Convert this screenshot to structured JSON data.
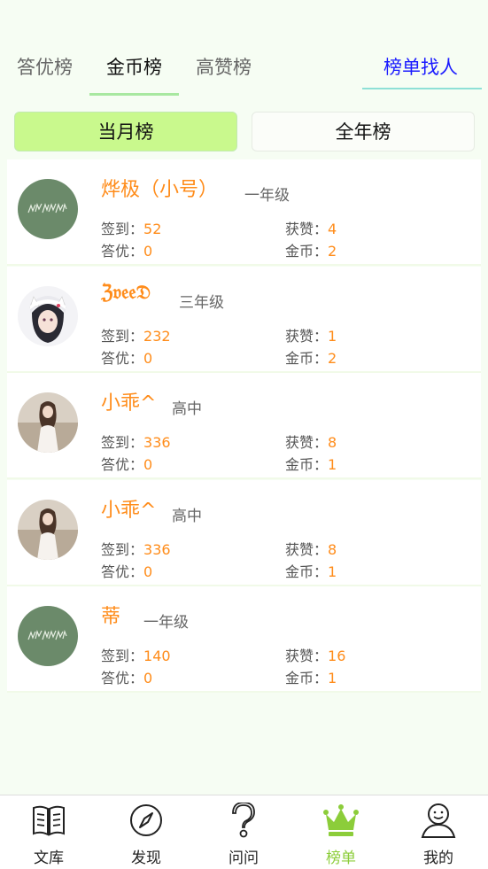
{
  "tabs": {
    "answer": "答优榜",
    "gold": "金币榜",
    "likes": "高赞榜",
    "finder": "榜单找人"
  },
  "segment": {
    "month": "当月榜",
    "year": "全年榜"
  },
  "labels": {
    "checkin": "签到：",
    "answer": "答优：",
    "likes": "获赞：",
    "gold": "金币："
  },
  "users": [
    {
      "name": "烨极（小号）",
      "grade": "一年级",
      "checkin": "52",
      "answer": "0",
      "likes": "4",
      "gold": "2"
    },
    {
      "name": "ℨ𝔳𝔢𝔢𝔇",
      "grade": "三年级",
      "checkin": "232",
      "answer": "0",
      "likes": "1",
      "gold": "2"
    },
    {
      "name": "小乖^",
      "grade": "高中",
      "checkin": "336",
      "answer": "0",
      "likes": "8",
      "gold": "1"
    },
    {
      "name": "小乖^",
      "grade": "高中",
      "checkin": "336",
      "answer": "0",
      "likes": "8",
      "gold": "1"
    },
    {
      "name": "蒂",
      "grade": "一年级",
      "checkin": "140",
      "answer": "0",
      "likes": "16",
      "gold": "1"
    }
  ],
  "nav": {
    "library": "文库",
    "discover": "发现",
    "ask": "问问",
    "ranking": "榜单",
    "mine": "我的"
  },
  "colors": {
    "accent_orange": "#ff8c1a",
    "active_green": "#8ccd3a",
    "segment_green": "#c9f98d",
    "finder_blue": "#1a1aff"
  },
  "icons": {
    "library": "book-icon",
    "discover": "compass-icon",
    "ask": "question-icon",
    "ranking": "crown-icon",
    "mine": "person-icon"
  }
}
